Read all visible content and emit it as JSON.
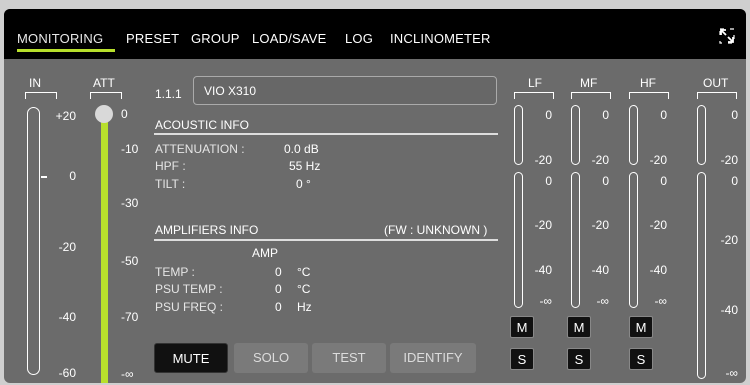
{
  "tabs": [
    "MONITORING",
    "PRESET",
    "GROUP",
    "LOAD/SAVE",
    "LOG",
    "INCLINOMETER"
  ],
  "input_meter": {
    "label": "IN",
    "ticks": [
      "+20",
      "0",
      "-20",
      "-40",
      "-60"
    ]
  },
  "att": {
    "label": "ATT",
    "ticks": [
      "0",
      "-10",
      "-30",
      "-50",
      "-70",
      "-∞"
    ]
  },
  "speaker": {
    "id": "1.1.1",
    "name": "VIO X310"
  },
  "acoustic": {
    "title": "ACOUSTIC INFO",
    "attenuation_label": "ATTENUATION :",
    "attenuation_value": "0.0 dB",
    "hpf_label": "HPF :",
    "hpf_value": "55 Hz",
    "tilt_label": "TILT :",
    "tilt_value": "0 °"
  },
  "amplifiers": {
    "title": "AMPLIFIERS INFO",
    "fw": "(FW : UNKNOWN )",
    "amp": "AMP",
    "temp_label": "TEMP :",
    "temp_value": "0",
    "temp_unit": "°C",
    "psu_temp_label": "PSU TEMP :",
    "psu_temp_value": "0",
    "psu_temp_unit": "°C",
    "psu_freq_label": "PSU FREQ :",
    "psu_freq_value": "0",
    "psu_freq_unit": "Hz"
  },
  "buttons": {
    "mute": "MUTE",
    "solo": "SOLO",
    "test": "TEST",
    "identify": "IDENTIFY"
  },
  "bands": [
    {
      "label": "LF",
      "top": [
        "0",
        "-20"
      ],
      "bottom": [
        "0",
        "-20",
        "-40",
        "-∞"
      ],
      "m": "M",
      "s": "S"
    },
    {
      "label": "MF",
      "top": [
        "0",
        "-20"
      ],
      "bottom": [
        "0",
        "-20",
        "-40",
        "-∞"
      ],
      "m": "M",
      "s": "S"
    },
    {
      "label": "HF",
      "top": [
        "0",
        "-20"
      ],
      "bottom": [
        "0",
        "-20",
        "-40",
        "-∞"
      ],
      "m": "M",
      "s": "S"
    }
  ],
  "output_meter": {
    "label": "OUT",
    "ticks": [
      "0",
      "-20",
      "0",
      "-20",
      "-40",
      "-∞"
    ]
  },
  "colors": {
    "accent": "#b8e02c",
    "panel": "#6b6b6b",
    "topbar": "#000000"
  }
}
